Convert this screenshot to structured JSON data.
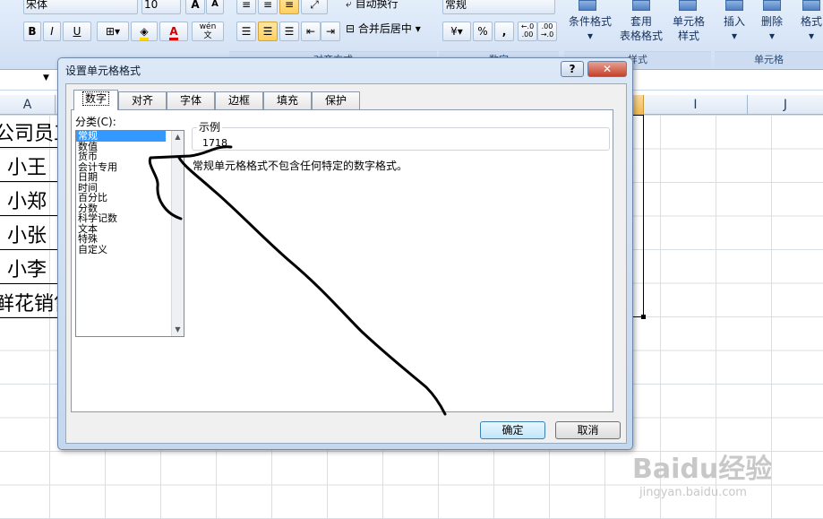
{
  "ribbon": {
    "font_name": "宋体",
    "font_size": "10",
    "bold": "B",
    "italic": "I",
    "underline": "U",
    "font_color_letter": "A",
    "wen_label": "wén\n文",
    "wrap_text": "自动换行",
    "merge_center": "合并后居中",
    "number_format": "常规",
    "percent": "%",
    "comma": ",",
    "inc_decimal": "←.0\n.00",
    "dec_decimal": ".00\n→.0",
    "cond_format": "条件格式",
    "table_format": "套用\n表格格式",
    "cell_style": "单元格\n样式",
    "insert": "插入",
    "delete": "删除",
    "format": "格式",
    "group_align": "对齐方式",
    "group_number": "数字",
    "group_style": "样式",
    "group_cells": "单元格"
  },
  "sheet": {
    "columns": [
      "A",
      "I",
      "J"
    ],
    "cells": [
      "公司员工",
      "小王",
      "小郑",
      "小张",
      "小李",
      "鲜花销售"
    ]
  },
  "dialog": {
    "title": "设置单元格格式",
    "help": "?",
    "close": "✕",
    "tabs": [
      "数字",
      "对齐",
      "字体",
      "边框",
      "填充",
      "保护"
    ],
    "category_label": "分类(C):",
    "categories": [
      "常规",
      "数值",
      "货币",
      "会计专用",
      "日期",
      "时间",
      "百分比",
      "分数",
      "科学记数",
      "文本",
      "特殊",
      "自定义"
    ],
    "sample_label": "示例",
    "sample_value": "1718",
    "description": "常规单元格格式不包含任何特定的数字格式。",
    "ok": "确定",
    "cancel": "取消"
  },
  "watermark": {
    "logo": "Baidu经验",
    "url": "jingyan.baidu.com"
  },
  "colors": {
    "ribbon_top": "#e4eefb",
    "selection": "#3399ff",
    "pen_stroke": "#000000"
  }
}
